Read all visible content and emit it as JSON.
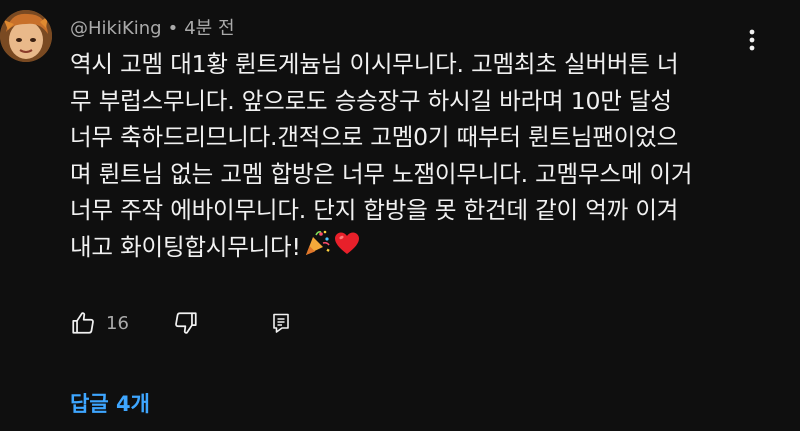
{
  "comment": {
    "author": "@HikiKing",
    "separator": "•",
    "time": "4분 전",
    "lines": [
      "역시 고멤 대1황 륀트게늄님 이시무니다. 고멤최초 실버버튼 너",
      "무 부럽스무니다. 앞으로도 승승장구 하시길 바라며 10만 달성",
      "너무 축하드리므니다.갠적으로 고멤0기 때부터 륀트님팬이었으",
      "며 륀트님 없는 고멤 합방은 너무 노잼이무니다. 고멤무스메 이거",
      "너무 주작 에바이무니다. 단지 합방을 못 한건데 같이 억까 이겨",
      "내고 화이팅합시무니다!"
    ],
    "trailing_emojis": [
      "party-popper",
      "red-heart"
    ],
    "like_count": "16",
    "replies_label": "답글 4개"
  },
  "colors": {
    "background": "#0f0f0f",
    "text": "#f1f1f1",
    "muted": "#aaaaaa",
    "link": "#3ea6ff"
  },
  "icons": {
    "like": "thumb-up-icon",
    "dislike": "thumb-down-icon",
    "reply": "reply-icon",
    "menu": "more-vert-icon"
  }
}
